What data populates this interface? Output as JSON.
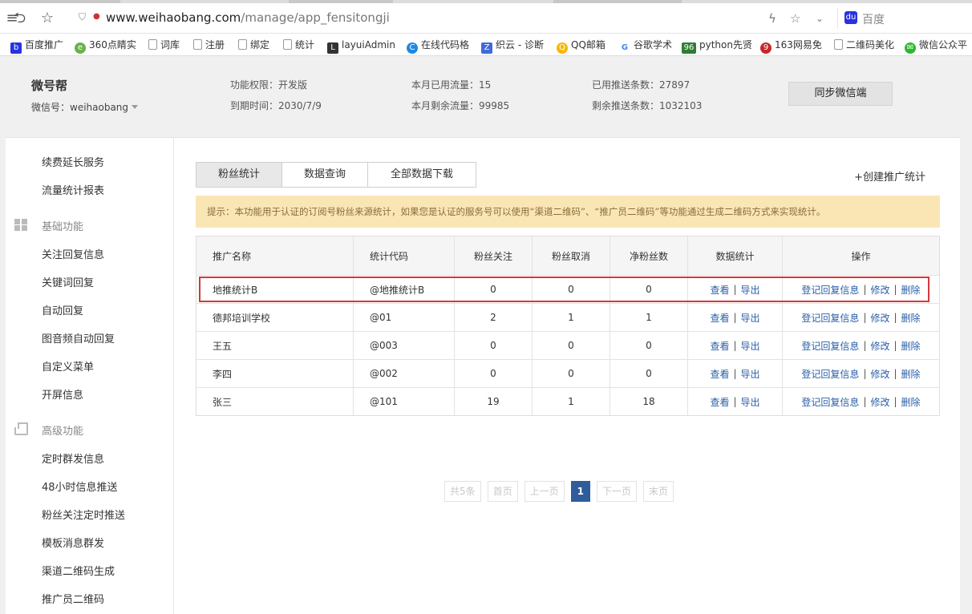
{
  "browser": {
    "url_host": "www.weihaobang.com",
    "url_path": "/manage/app_fensitongji",
    "search_label": "百度",
    "bookmarks": [
      "百度推广",
      "360点睛实",
      "词库",
      "注册",
      "绑定",
      "统计",
      "layuiAdmin",
      "在线代码格",
      "织云 - 诊断",
      "QQ邮箱",
      "谷歌学术",
      "python先贤",
      "163网易免",
      "二维码美化",
      "微信公众平"
    ]
  },
  "header": {
    "brand": "微号帮",
    "wechat_id": "微信号：weihaobang",
    "permission": "功能权限：开发版",
    "expire": "到期时间：2030/7/9",
    "traffic_used": "本月已用流量：15",
    "traffic_left": "本月剩余流量：99985",
    "push_used": "已用推送条数：27897",
    "push_left": "剩余推送条数：1032103",
    "sync_button": "同步微信端"
  },
  "sidebar": {
    "items_top": [
      "续费延长服务",
      "流量统计报表"
    ],
    "group_basic": "基础功能",
    "items_basic": [
      "关注回复信息",
      "关键词回复",
      "自动回复",
      "图音频自动回复",
      "自定义菜单",
      "开屏信息"
    ],
    "group_advanced": "高级功能",
    "items_advanced": [
      "定时群发信息",
      "48小时信息推送",
      "粉丝关注定时推送",
      "模板消息群发",
      "渠道二维码生成",
      "推广员二维码"
    ]
  },
  "main": {
    "tabs": [
      "粉丝统计",
      "数据查询",
      "全部数据下载"
    ],
    "create_link": "+创建推广统计",
    "tip": "提示：本功能用于认证的订阅号粉丝来源统计，如果您是认证的服务号可以使用“渠道二维码”、“推广员二维码”等功能通过生成二维码方式来实现统计。",
    "columns": [
      "推广名称",
      "统计代码",
      "粉丝关注",
      "粉丝取消",
      "净粉丝数",
      "数据统计",
      "操作"
    ],
    "rows": [
      {
        "name": "地推统计B",
        "code": "@地推统计B",
        "follow": "0",
        "cancel": "0",
        "net": "0"
      },
      {
        "name": "德邦培训学校",
        "code": "@01",
        "follow": "2",
        "cancel": "1",
        "net": "1"
      },
      {
        "name": "王五",
        "code": "@003",
        "follow": "0",
        "cancel": "0",
        "net": "0"
      },
      {
        "name": "李四",
        "code": "@002",
        "follow": "0",
        "cancel": "0",
        "net": "0"
      },
      {
        "name": "张三",
        "code": "@101",
        "follow": "19",
        "cancel": "1",
        "net": "18"
      }
    ],
    "link_view": "查看",
    "link_export": "导出",
    "link_register": "登记回复信息",
    "link_edit": "修改",
    "link_delete": "删除",
    "separator": "|",
    "highlighted_row": 0
  },
  "pager": {
    "total": "共5条",
    "first": "首页",
    "prev": "上一页",
    "current": "1",
    "next": "下一页",
    "last": "末页"
  }
}
